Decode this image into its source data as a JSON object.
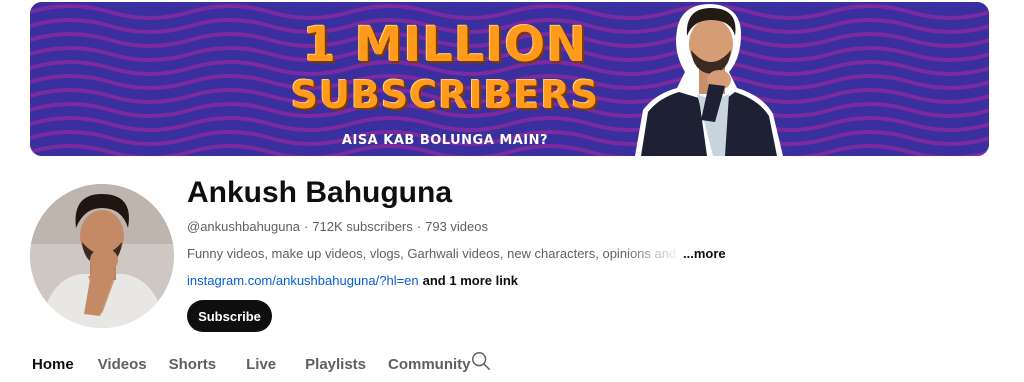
{
  "banner": {
    "line1": "1 MILLION",
    "line2": "SUBSCRIBERS",
    "tagline": "AISA KAB BOLUNGA MAIN?",
    "colors": {
      "background": "#3a2f9e",
      "pattern": "#7b2aa0",
      "headline": "#ff9a1a"
    }
  },
  "channel": {
    "name": "Ankush Bahuguna",
    "handle": "@ankushbahuguna",
    "subscribers": "712K subscribers",
    "videos": "793 videos",
    "separator": "·",
    "description": "Funny videos, make up videos, vlogs, Garhwali videos, new characters, opinions and a lot",
    "more_label": "...more",
    "link": "instagram.com/ankushbahuguna/?hl=en",
    "extra_links": "and 1 more link",
    "subscribe_label": "Subscribe"
  },
  "tabs": [
    {
      "label": "Home",
      "active": true
    },
    {
      "label": "Videos",
      "active": false
    },
    {
      "label": "Shorts",
      "active": false
    },
    {
      "label": "Live",
      "active": false
    },
    {
      "label": "Playlists",
      "active": false
    },
    {
      "label": "Community",
      "active": false
    }
  ],
  "icons": {
    "search": "search-icon"
  }
}
